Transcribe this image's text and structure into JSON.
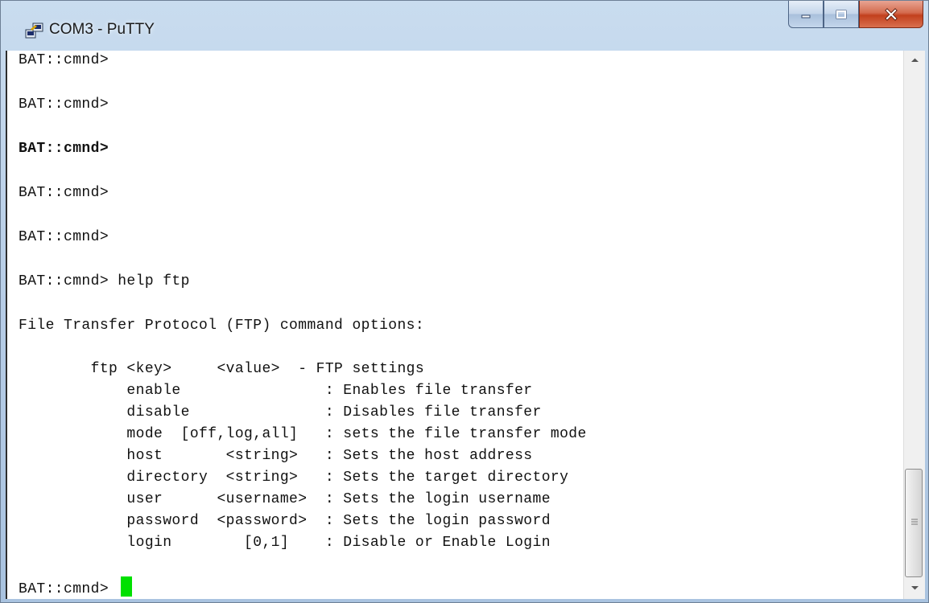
{
  "window": {
    "title": "COM3 - PuTTY",
    "icon": "putty-icon",
    "controls": [
      "minimize-icon",
      "maximize-icon",
      "close-icon"
    ]
  },
  "terminal": {
    "lines": [
      "BAT::cmnd>",
      "BAT::cmnd>",
      "BAT::cmnd>",
      "BAT::cmnd>",
      "BAT::cmnd>",
      "BAT::cmnd> help ftp",
      "File Transfer Protocol (FTP) command options:",
      "        ftp <key>     <value>  - FTP settings",
      "            enable                : Enables file transfer",
      "            disable               : Disables file transfer",
      "            mode  [off,log,all]   : sets the file transfer mode",
      "            host       <string>   : Sets the host address",
      "            directory  <string>   : Sets the target directory",
      "            user      <username>  : Sets the login username",
      "            password  <password>  : Sets the login password",
      "            login        [0,1]    : Disable or Enable Login",
      "BAT::cmnd> "
    ],
    "cursor_color": "#00e000",
    "background": "#ffffff",
    "foreground": "#111111"
  },
  "scrollbar": {
    "position_fraction": 1.0
  }
}
